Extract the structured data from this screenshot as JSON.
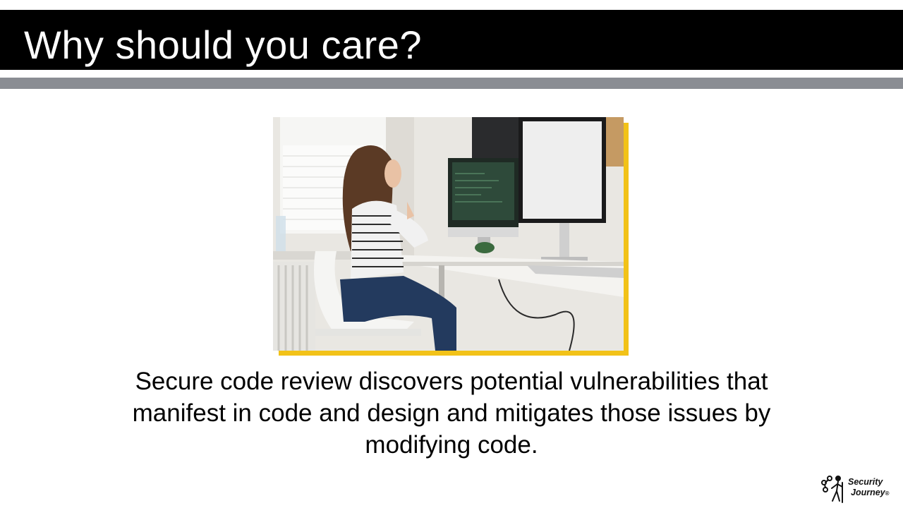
{
  "slide": {
    "title": "Why should you care?",
    "body": "Secure code review discovers potential vulnerabilities that manifest in code and design and mitigates those issues by modifying code."
  },
  "logo": {
    "line1": "Security",
    "line2": "Journey",
    "mark": "®"
  },
  "colors": {
    "title_bar": "#000000",
    "rule": "#8a8d93",
    "photo_accent": "#f2c218"
  },
  "image": {
    "subject": "woman-at-desk-with-computer-monitors-photo"
  }
}
